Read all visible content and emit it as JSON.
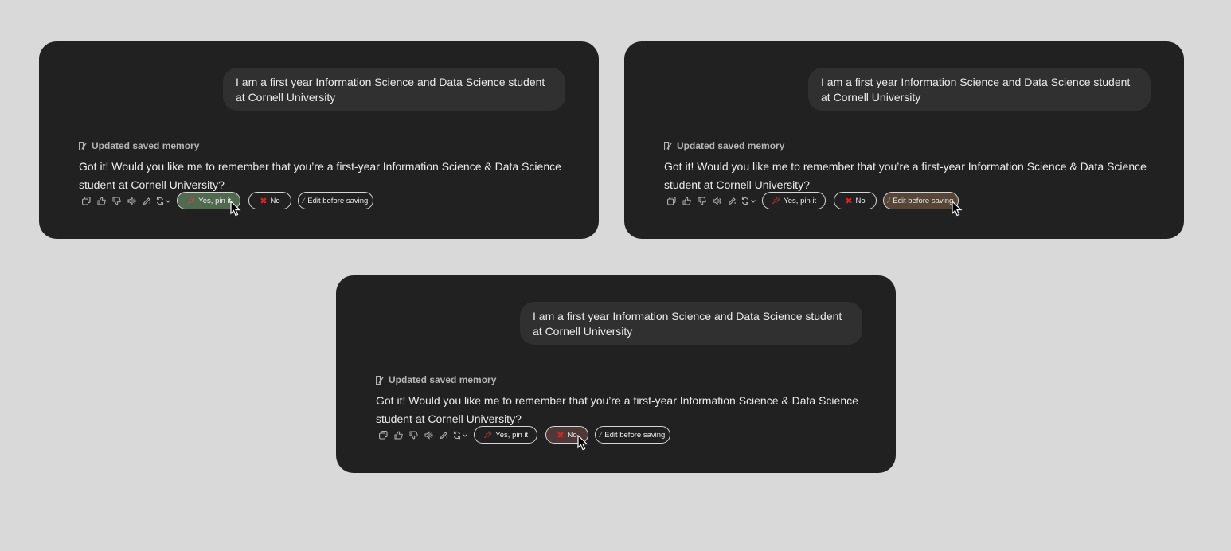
{
  "panels": [
    {
      "user_message": "I am a first year Information Science and Data Science student at Cornell University",
      "memory_label": "Updated saved memory",
      "assistant_reply": "Got it! Would you like me to remember that you’re a first-year Information Science & Data Science student at Cornell University?",
      "buttons": {
        "yes": "Yes, pin it",
        "no": "No",
        "edit": "Edit before saving"
      },
      "highlighted": "yes"
    },
    {
      "user_message": "I am a first year Information Science and Data Science student at Cornell University",
      "memory_label": "Updated saved memory",
      "assistant_reply": "Got it! Would you like me to remember that you’re a first-year Information Science & Data Science student at Cornell University?",
      "buttons": {
        "yes": "Yes, pin it",
        "no": "No",
        "edit": "Edit before saving"
      },
      "highlighted": "edit"
    },
    {
      "user_message": "I am a first year Information Science and Data Science student at Cornell University",
      "memory_label": "Updated saved memory",
      "assistant_reply": "Got it! Would you like me to remember that you’re a first-year Information Science & Data Science student at Cornell University?",
      "buttons": {
        "yes": "Yes, pin it",
        "no": "No",
        "edit": "Edit before saving"
      },
      "highlighted": "no"
    }
  ],
  "icons": [
    "copy-icon",
    "thumbs-up-icon",
    "thumbs-down-icon",
    "speaker-icon",
    "edit-icon",
    "regenerate-icon",
    "chevron-down-icon",
    "pin-icon",
    "x-icon",
    "pencil-icon",
    "cursor-icon"
  ],
  "colors": {
    "background": "#d9d9d9",
    "panel": "#212121",
    "bubble": "#303030",
    "yes_active": "#4f6a4f",
    "no_active": "#4e3838",
    "edit_active": "#574637",
    "pin": "#e0424b"
  }
}
